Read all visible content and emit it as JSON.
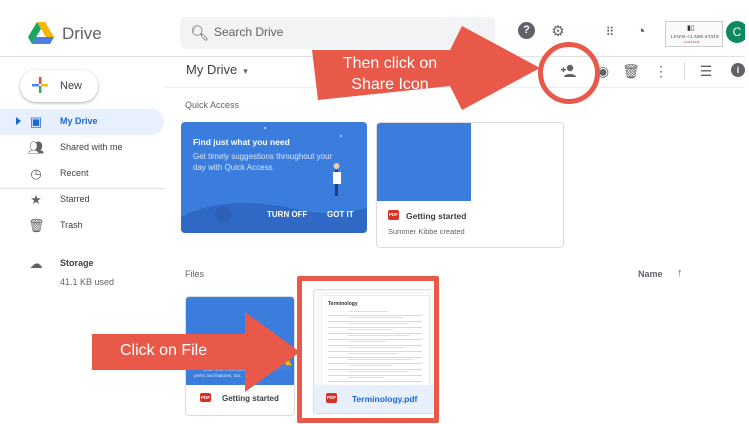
{
  "header": {
    "app_name": "Drive",
    "search_placeholder": "Search Drive",
    "help_label": "?",
    "brand_line1": "LEWIS·CLARK STATE",
    "brand_line2": "COLLEGE",
    "avatar_letter": "C"
  },
  "sidebar": {
    "new_label": "New",
    "items": [
      {
        "label": "My Drive",
        "icon": "my-drive-icon",
        "active": true
      },
      {
        "label": "Shared with me",
        "icon": "people-icon"
      },
      {
        "label": "Recent",
        "icon": "clock-icon"
      },
      {
        "label": "Starred",
        "icon": "star-icon"
      },
      {
        "label": "Trash",
        "icon": "trash-icon"
      }
    ],
    "storage_label": "Storage",
    "storage_used": "41.1 KB used"
  },
  "main": {
    "title": "My Drive",
    "dropdown_glyph": "▾",
    "quick_access_label": "Quick Access",
    "promo": {
      "heading": "Find just what you need",
      "body": "Get timely suggestions throughout your day with Quick Access",
      "turn_off": "TURN OFF",
      "got_it": "GOT IT"
    },
    "qa_file": {
      "name": "Getting started",
      "subtitle": "Summer Kibbe created",
      "type": "PDF"
    },
    "files_label": "Files",
    "sort_label": "Name",
    "files": [
      {
        "name": "Getting started",
        "type": "PDF",
        "thumb_line1": "your work. And more",
        "thumb_line2": "perks and features, too."
      },
      {
        "name": "Terminology.pdf",
        "type": "PDF",
        "doc_title": "Terminology"
      }
    ]
  },
  "annotations": {
    "share_callout": "Then click on Share Icon",
    "file_callout": "Click on File",
    "highlight_color": "#e8594a"
  }
}
